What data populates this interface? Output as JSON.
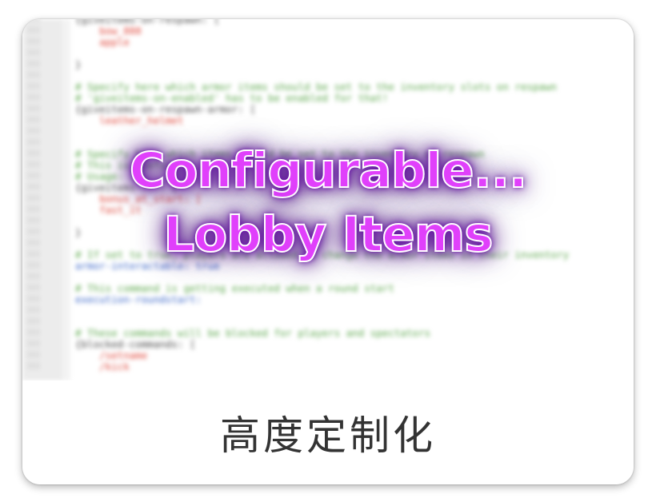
{
  "overlay": {
    "line1": "Configurable...",
    "line2": "Lobby Items"
  },
  "caption": {
    "text": "高度定制化"
  },
  "colors": {
    "title_fill": "#e040fb",
    "title_glow": "#6a0dad",
    "comment": "#5aa64a",
    "item": "#e0483c",
    "keyword": "#3a66c8"
  },
  "code": {
    "lines": [
      {
        "text": "{giveitems-on-respawn: [",
        "kind": "key"
      },
      {
        "text": "    bow_888",
        "kind": "item"
      },
      {
        "text": "    apple",
        "kind": "item"
      },
      {
        "text": "",
        "kind": "key"
      },
      {
        "text": "}",
        "kind": "key"
      },
      {
        "text": "",
        "kind": "key"
      },
      {
        "text": "# Specify here which armor items should be set to the inventory slots on respawn",
        "kind": "comment"
      },
      {
        "text": "# 'giveitems-on-enabled' has to be enabled for that!",
        "kind": "comment"
      },
      {
        "text": "{giveitems-on-respawn-armor: [",
        "kind": "key"
      },
      {
        "text": "    leather_helmet",
        "kind": "item"
      },
      {
        "text": "",
        "kind": "key"
      },
      {
        "text": "",
        "kind": "key"
      },
      {
        "text": "# Specify here which items should be set to the inventory on respawn",
        "kind": "comment"
      },
      {
        "text": "# This is useful",
        "kind": "comment"
      },
      {
        "text": "# Usage: ...",
        "kind": "comment"
      },
      {
        "text": "{giveitems-...: [",
        "kind": "key"
      },
      {
        "text": "    bonus_at_start: [",
        "kind": "item"
      },
      {
        "text": "    fast_it",
        "kind": "item"
      },
      {
        "text": "",
        "kind": "key"
      },
      {
        "text": "}",
        "kind": "key"
      },
      {
        "text": "",
        "kind": "key"
      },
      {
        "text": "# If set to true, players are allowed to change the armor items in their inventory",
        "kind": "comment"
      },
      {
        "text": "armor-interactable: true",
        "kind": "blue"
      },
      {
        "text": "",
        "kind": "key"
      },
      {
        "text": "# This command is getting executed when a round start",
        "kind": "comment"
      },
      {
        "text": "execution-roundstart:",
        "kind": "blue"
      },
      {
        "text": "",
        "kind": "key"
      },
      {
        "text": "",
        "kind": "key"
      },
      {
        "text": "# These commands will be blocked for players and spectators",
        "kind": "comment"
      },
      {
        "text": "{blocked-commands: [",
        "kind": "key"
      },
      {
        "text": "    /setname",
        "kind": "item"
      },
      {
        "text": "    /kick",
        "kind": "item"
      }
    ]
  }
}
